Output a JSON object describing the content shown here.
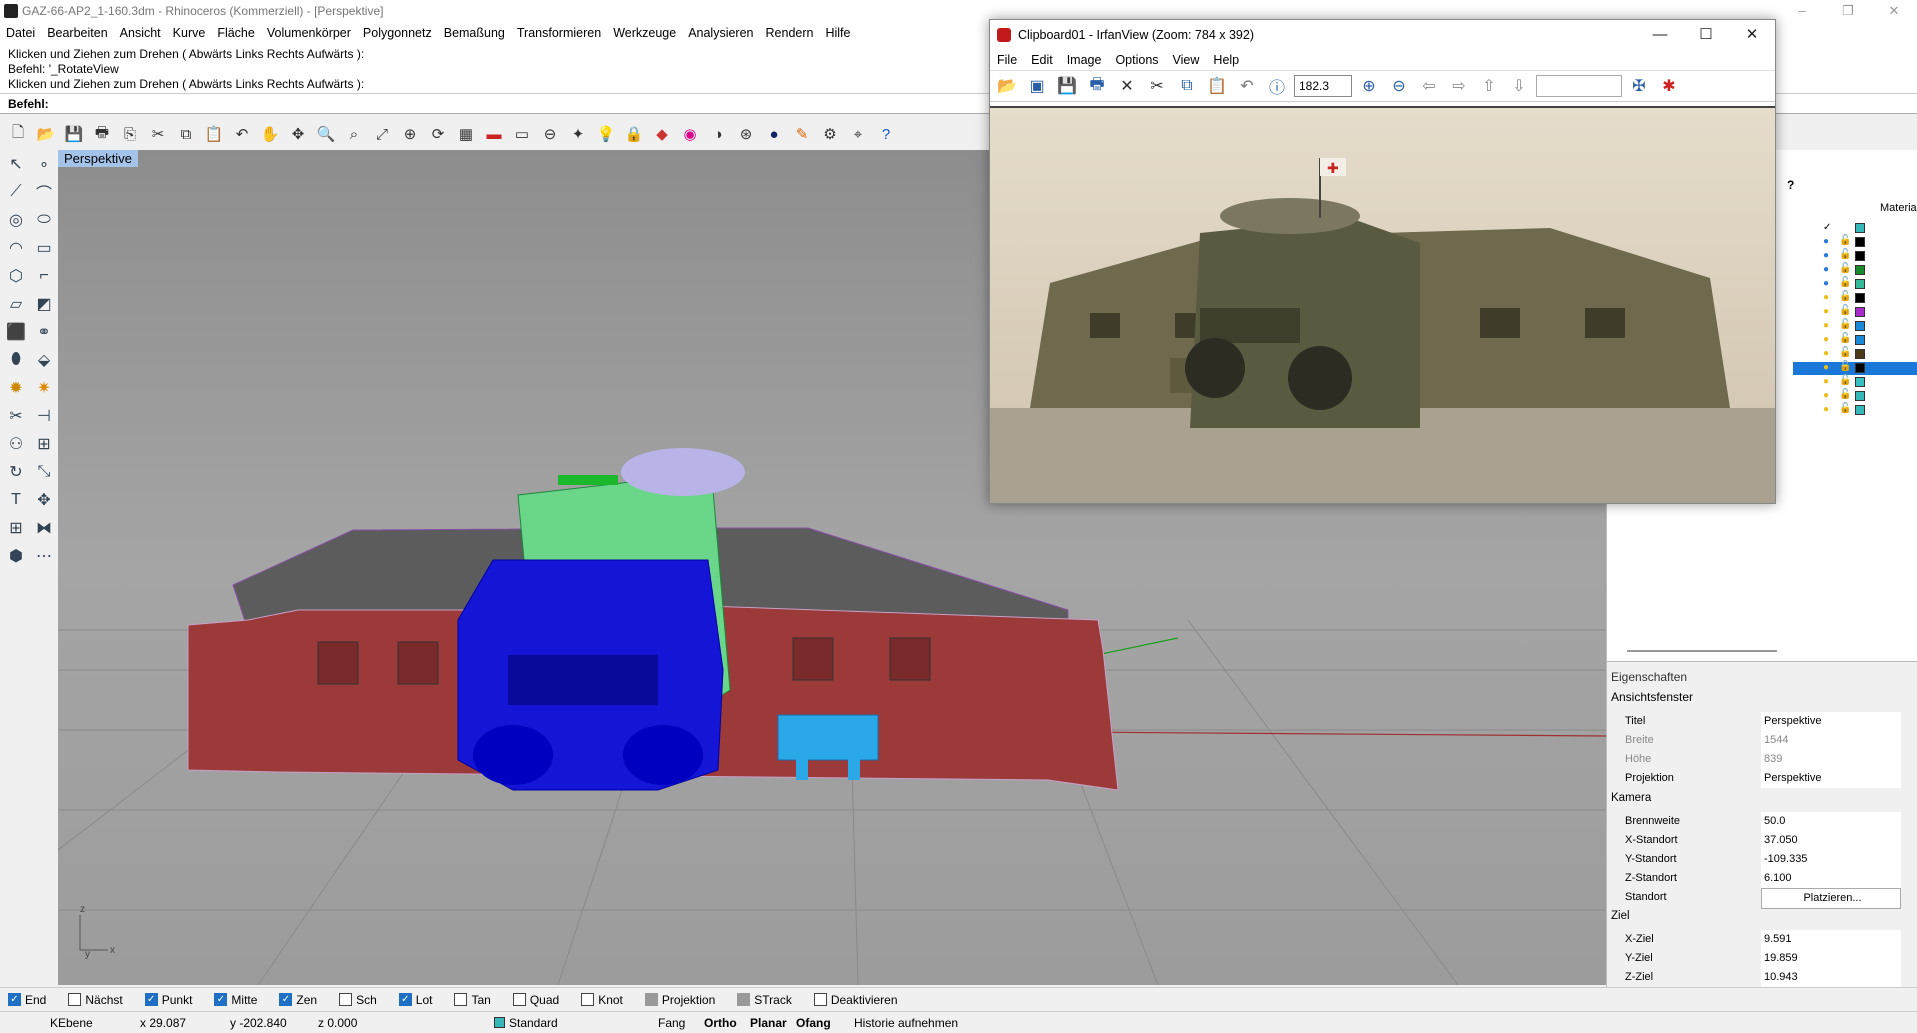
{
  "rhino": {
    "title": "GAZ-66-AP2_1-160.3dm - Rhinoceros (Kommerziell) - [Perspektive]",
    "menu": [
      "Datei",
      "Bearbeiten",
      "Ansicht",
      "Kurve",
      "Fläche",
      "Volumenkörper",
      "Polygonnetz",
      "Bemaßung",
      "Transformieren",
      "Werkzeuge",
      "Analysieren",
      "Rendern",
      "Hilfe"
    ],
    "command_history": [
      "Klicken und Ziehen zum Drehen ( Abwärts  Links  Rechts  Aufwärts ):",
      "Befehl: '_RotateView",
      "Klicken und Ziehen zum Drehen ( Abwärts  Links  Rechts  Aufwärts ):"
    ],
    "command_prompt": "Befehl:",
    "viewport_label": "Perspektive",
    "axis_labels": {
      "z": "z",
      "y": "y",
      "x": "x"
    },
    "snaps": [
      {
        "label": "End",
        "checked": true
      },
      {
        "label": "Nächst",
        "checked": false
      },
      {
        "label": "Punkt",
        "checked": true
      },
      {
        "label": "Mitte",
        "checked": true
      },
      {
        "label": "Zen",
        "checked": true
      },
      {
        "label": "Sch",
        "checked": false
      },
      {
        "label": "Lot",
        "checked": true
      },
      {
        "label": "Tan",
        "checked": false
      },
      {
        "label": "Quad",
        "checked": false
      },
      {
        "label": "Knot",
        "checked": false
      },
      {
        "label": "Projektion",
        "checked": "gray"
      },
      {
        "label": "STrack",
        "checked": "gray"
      },
      {
        "label": "Deaktivieren",
        "checked": false
      }
    ],
    "status": {
      "layer": "KEbene",
      "x": "x 29.087",
      "y": "y -202.840",
      "z": "z 0.000",
      "layer_name": "Standard",
      "fang": "Fang",
      "ortho": "Ortho",
      "planar": "Planar",
      "ofang": "Ofang",
      "historie": "Historie aufnehmen"
    },
    "layers_panel": {
      "help": "?",
      "material_header": "Material",
      "colors": [
        "#36b8b8",
        "#000000",
        "#000000",
        "#1a8a2a",
        "#36b89a",
        "#000000",
        "#a82ac8",
        "#1a8ad8",
        "#1a8ad8",
        "#4a3a1a",
        "#000000",
        "#36c0c0",
        "#36b8b8",
        "#36b8b8"
      ]
    },
    "properties": {
      "title": "Eigenschaften",
      "subtitle": "Ansichtsfenster",
      "rows": [
        {
          "k": "Titel",
          "v": "Perspektive",
          "dim": false
        },
        {
          "k": "Breite",
          "v": "1544",
          "dim": true
        },
        {
          "k": "Höhe",
          "v": "839",
          "dim": true
        },
        {
          "k": "Projektion",
          "v": "Perspektive",
          "dim": false
        }
      ],
      "camera_label": "Kamera",
      "camera": [
        {
          "k": "Brennweite",
          "v": "50.0"
        },
        {
          "k": "X-Standort",
          "v": "37.050"
        },
        {
          "k": "Y-Standort",
          "v": "-109.335"
        },
        {
          "k": "Z-Standort",
          "v": "6.100"
        },
        {
          "k": "Standort",
          "v": "Platzieren..."
        }
      ],
      "target_label": "Ziel",
      "target": [
        {
          "k": "X-Ziel",
          "v": "9.591"
        },
        {
          "k": "Y-Ziel",
          "v": "19.859"
        },
        {
          "k": "Z-Ziel",
          "v": "10.943"
        }
      ]
    }
  },
  "irfanview": {
    "title": "Clipboard01 - IrfanView (Zoom: 784 x 392)",
    "menu": [
      "File",
      "Edit",
      "Image",
      "Options",
      "View",
      "Help"
    ],
    "zoom_value": "182.3"
  }
}
